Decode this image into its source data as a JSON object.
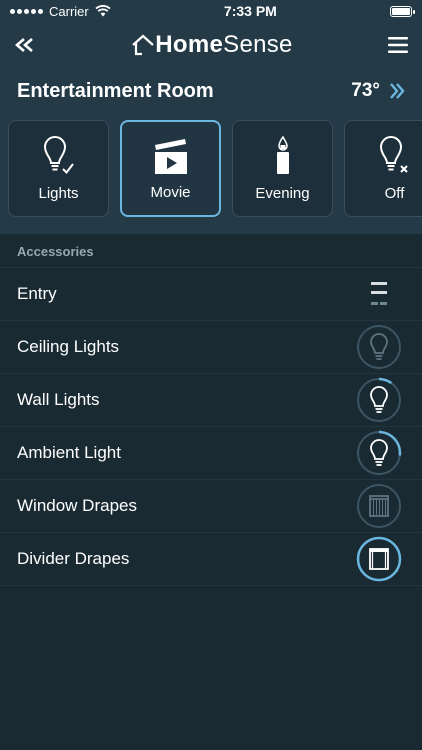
{
  "status": {
    "carrier": "Carrier",
    "time": "7:33 PM"
  },
  "nav": {
    "brand_home": "Home",
    "brand_sense": "Sense"
  },
  "room": {
    "title": "Entertainment Room",
    "temperature": "73°"
  },
  "scenes": [
    {
      "label": "Lights",
      "icon": "bulb-check-icon",
      "selected": false
    },
    {
      "label": "Movie",
      "icon": "clapperboard-icon",
      "selected": true
    },
    {
      "label": "Evening",
      "icon": "candle-icon",
      "selected": false
    },
    {
      "label": "Off",
      "icon": "bulb-off-icon",
      "selected": false
    }
  ],
  "accessories": {
    "header": "Accessories",
    "items": [
      {
        "label": "Entry",
        "icon": "lock-icon",
        "level": null
      },
      {
        "label": "Ceiling Lights",
        "icon": "bulb-icon",
        "level": 0
      },
      {
        "label": "Wall Lights",
        "icon": "bulb-icon",
        "level": 0.15
      },
      {
        "label": "Ambient Light",
        "icon": "bulb-icon",
        "level": 0.3
      },
      {
        "label": "Window Drapes",
        "icon": "drapes-closed-icon",
        "level": 0
      },
      {
        "label": "Divider Drapes",
        "icon": "drapes-open-icon",
        "level": 1
      }
    ]
  },
  "colors": {
    "accent": "#6cb7e0",
    "background": "#1a2a33",
    "bar": "#243a47"
  }
}
